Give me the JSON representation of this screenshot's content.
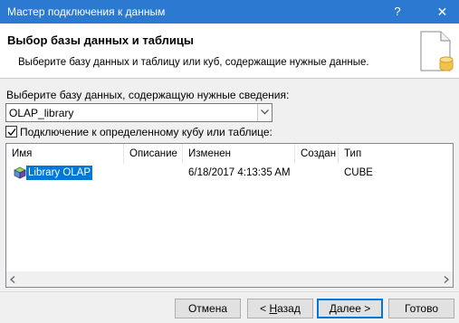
{
  "window": {
    "title": "Мастер подключения к данным",
    "help_label": "?",
    "close_label": "✕"
  },
  "header": {
    "title": "Выбор базы данных и таблицы",
    "subtitle": "Выберите базу данных и таблицу или куб, содержащие нужные данные."
  },
  "database": {
    "label": "Выберите базу данных, содержащую нужные сведения:",
    "selected": "OLAP_library"
  },
  "cube_option": {
    "label": "Подключение к определенному кубу или таблице:",
    "checked": true
  },
  "table": {
    "columns": [
      "Имя",
      "Описание",
      "Изменен",
      "Создан",
      "Тип"
    ],
    "rows": [
      {
        "name": "Library OLAP",
        "description": "",
        "modified": "6/18/2017 4:13:35 AM",
        "created": "",
        "type": "CUBE",
        "icon": "cube-icon"
      }
    ]
  },
  "buttons": {
    "cancel": "Отмена",
    "back_prefix": "< ",
    "back_key": "Н",
    "back_rest": "азад",
    "next_key": "Д",
    "next_rest": "алее >",
    "finish": "Готово"
  },
  "colors": {
    "titlebar": "#2b79d0",
    "selection": "#0078d7"
  }
}
